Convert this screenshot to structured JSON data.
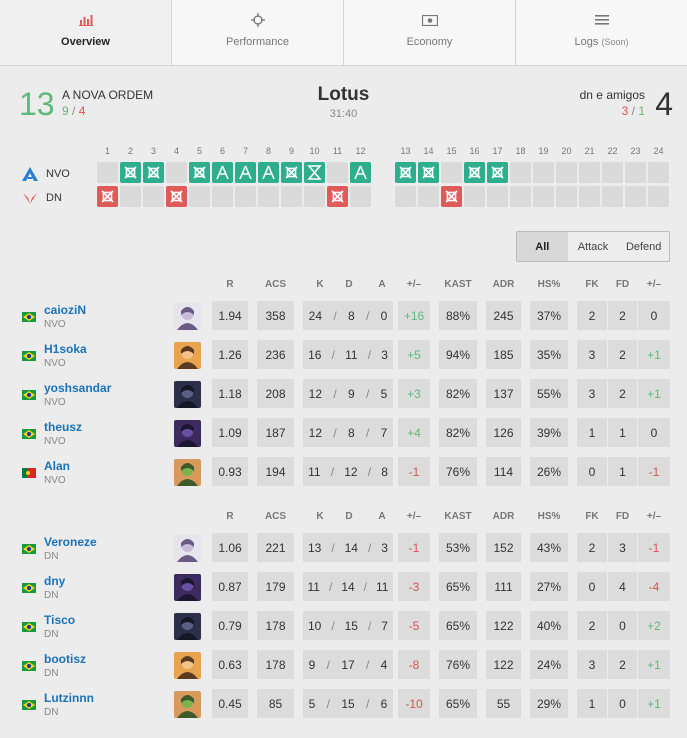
{
  "tabs": [
    {
      "label": "Overview",
      "icon": "bar-chart-icon",
      "active": true
    },
    {
      "label": "Performance",
      "icon": "crosshair-icon",
      "active": false
    },
    {
      "label": "Economy",
      "icon": "money-icon",
      "active": false
    },
    {
      "label": "Logs",
      "soon": "(Soon)",
      "icon": "list-icon",
      "active": false
    }
  ],
  "match": {
    "map": "Lotus",
    "duration": "31:40",
    "left": {
      "score": "13",
      "name": "A NOVA ORDEM",
      "atk": "9",
      "def": "4"
    },
    "right": {
      "score": "4",
      "name": "dn e amigos",
      "atk": "3",
      "def": "1"
    }
  },
  "rounds": {
    "numbers": [
      "1",
      "2",
      "3",
      "4",
      "5",
      "6",
      "7",
      "8",
      "9",
      "10",
      "11",
      "12",
      "13",
      "14",
      "15",
      "16",
      "17",
      "18",
      "19",
      "20",
      "21",
      "22",
      "23",
      "24"
    ],
    "teams": [
      {
        "abbr": "NVO",
        "logo": "nvo-logo-icon"
      },
      {
        "abbr": "DN",
        "logo": "dn-logo-icon"
      }
    ],
    "nvo": [
      "",
      "elim",
      "elim",
      "",
      "elim",
      "atk",
      "atk",
      "atk",
      "elim",
      "time",
      "",
      "atk",
      "elim",
      "elim",
      "",
      "elim",
      "elim",
      "",
      "",
      "",
      "",
      "",
      "",
      ""
    ],
    "dn": [
      "elim",
      "",
      "",
      "elim",
      "",
      "",
      "",
      "",
      "",
      "",
      "elim",
      "",
      "",
      "",
      "elim",
      "",
      "",
      "",
      "",
      "",
      "",
      "",
      "",
      ""
    ]
  },
  "filter": {
    "options": [
      "All",
      "Attack",
      "Defend"
    ],
    "selected": "All"
  },
  "columns": [
    "R",
    "ACS",
    "K",
    "D",
    "A",
    "+/–",
    "KAST",
    "ADR",
    "HS%",
    "FK",
    "FD",
    "+/–"
  ],
  "team1_players": [
    {
      "name": "caioziN",
      "team": "NVO",
      "flag": "br",
      "agent": "reyna",
      "r": "1.94",
      "acs": "358",
      "k": "24",
      "d": "8",
      "a": "0",
      "pm": "+16",
      "kast": "88%",
      "adr": "245",
      "hs": "37%",
      "fk": "2",
      "fd": "2",
      "fkpm": "0"
    },
    {
      "name": "H1soka",
      "team": "NVO",
      "flag": "br",
      "agent": "breach",
      "r": "1.26",
      "acs": "236",
      "k": "16",
      "d": "11",
      "a": "3",
      "pm": "+5",
      "kast": "94%",
      "adr": "185",
      "hs": "35%",
      "fk": "3",
      "fd": "2",
      "fkpm": "+1"
    },
    {
      "name": "yoshsandar",
      "team": "NVO",
      "flag": "br",
      "agent": "omen",
      "r": "1.18",
      "acs": "208",
      "k": "12",
      "d": "9",
      "a": "5",
      "pm": "+3",
      "kast": "82%",
      "adr": "137",
      "hs": "55%",
      "fk": "3",
      "fd": "2",
      "fkpm": "+1"
    },
    {
      "name": "theusz",
      "team": "NVO",
      "flag": "br",
      "agent": "viper",
      "r": "1.09",
      "acs": "187",
      "k": "12",
      "d": "8",
      "a": "7",
      "pm": "+4",
      "kast": "82%",
      "adr": "126",
      "hs": "39%",
      "fk": "1",
      "fd": "1",
      "fkpm": "0"
    },
    {
      "name": "Alan",
      "team": "NVO",
      "flag": "pt",
      "agent": "skye",
      "r": "0.93",
      "acs": "194",
      "k": "11",
      "d": "12",
      "a": "8",
      "pm": "-1",
      "kast": "76%",
      "adr": "114",
      "hs": "26%",
      "fk": "0",
      "fd": "1",
      "fkpm": "-1"
    }
  ],
  "team2_players": [
    {
      "name": "Veroneze",
      "team": "DN",
      "flag": "br",
      "agent": "reyna",
      "r": "1.06",
      "acs": "221",
      "k": "13",
      "d": "14",
      "a": "3",
      "pm": "-1",
      "kast": "53%",
      "adr": "152",
      "hs": "43%",
      "fk": "2",
      "fd": "3",
      "fkpm": "-1"
    },
    {
      "name": "dny",
      "team": "DN",
      "flag": "br",
      "agent": "viper",
      "r": "0.87",
      "acs": "179",
      "k": "11",
      "d": "14",
      "a": "11",
      "pm": "-3",
      "kast": "65%",
      "adr": "111",
      "hs": "27%",
      "fk": "0",
      "fd": "4",
      "fkpm": "-4"
    },
    {
      "name": "Tisco",
      "team": "DN",
      "flag": "br",
      "agent": "omen",
      "r": "0.79",
      "acs": "178",
      "k": "10",
      "d": "15",
      "a": "7",
      "pm": "-5",
      "kast": "65%",
      "adr": "122",
      "hs": "40%",
      "fk": "2",
      "fd": "0",
      "fkpm": "+2"
    },
    {
      "name": "bootisz",
      "team": "DN",
      "flag": "br",
      "agent": "breach",
      "r": "0.63",
      "acs": "178",
      "k": "9",
      "d": "17",
      "a": "4",
      "pm": "-8",
      "kast": "76%",
      "adr": "122",
      "hs": "24%",
      "fk": "3",
      "fd": "2",
      "fkpm": "+1"
    },
    {
      "name": "Lutzinnn",
      "team": "DN",
      "flag": "br",
      "agent": "skye",
      "r": "0.45",
      "acs": "85",
      "k": "5",
      "d": "15",
      "a": "6",
      "pm": "-10",
      "kast": "65%",
      "adr": "55",
      "hs": "29%",
      "fk": "1",
      "fd": "0",
      "fkpm": "+1"
    }
  ],
  "colors": {
    "green": "#5fb97a",
    "red": "#d9534f",
    "teal": "#2fae8e",
    "roundRed": "#e05a5a",
    "link": "#1a73b8"
  }
}
